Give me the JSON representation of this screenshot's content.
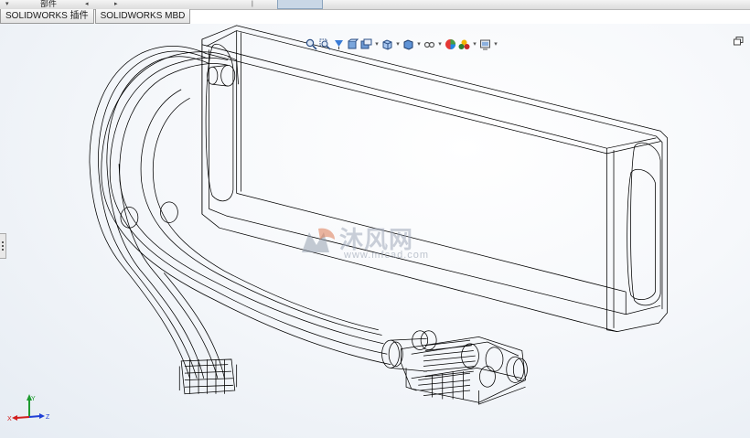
{
  "top_menu": {
    "part_tab": "部件"
  },
  "addin_tabs": [
    {
      "label": "SOLIDWORKS 插件"
    },
    {
      "label": "SOLIDWORKS MBD"
    }
  ],
  "heads_up_toolbar": [
    {
      "icon": "zoom-to-fit-icon"
    },
    {
      "icon": "zoom-to-area-icon"
    },
    {
      "icon": "previous-view-icon"
    },
    {
      "icon": "section-view-icon"
    },
    {
      "icon": "dynamic-annotation-view-icon"
    },
    {
      "icon": "view-orientation-icon"
    },
    {
      "icon": "display-style-icon"
    },
    {
      "icon": "hide-show-items-icon"
    },
    {
      "icon": "edit-appearance-icon"
    },
    {
      "icon": "apply-scene-icon"
    },
    {
      "icon": "view-settings-icon"
    }
  ],
  "watermark": {
    "cn_text": "沐风网",
    "url_text": "www.mfcad.com"
  },
  "triad": {
    "x": "X",
    "y": "Y",
    "z": "Z",
    "colors": {
      "x": "#d21e1e",
      "y": "#1e9b2f",
      "z": "#1f3fd6"
    }
  },
  "colors": {
    "model_line": "#000000",
    "viewport_bg": "#eef2f7",
    "tab_bg": "#e6e6e6"
  }
}
